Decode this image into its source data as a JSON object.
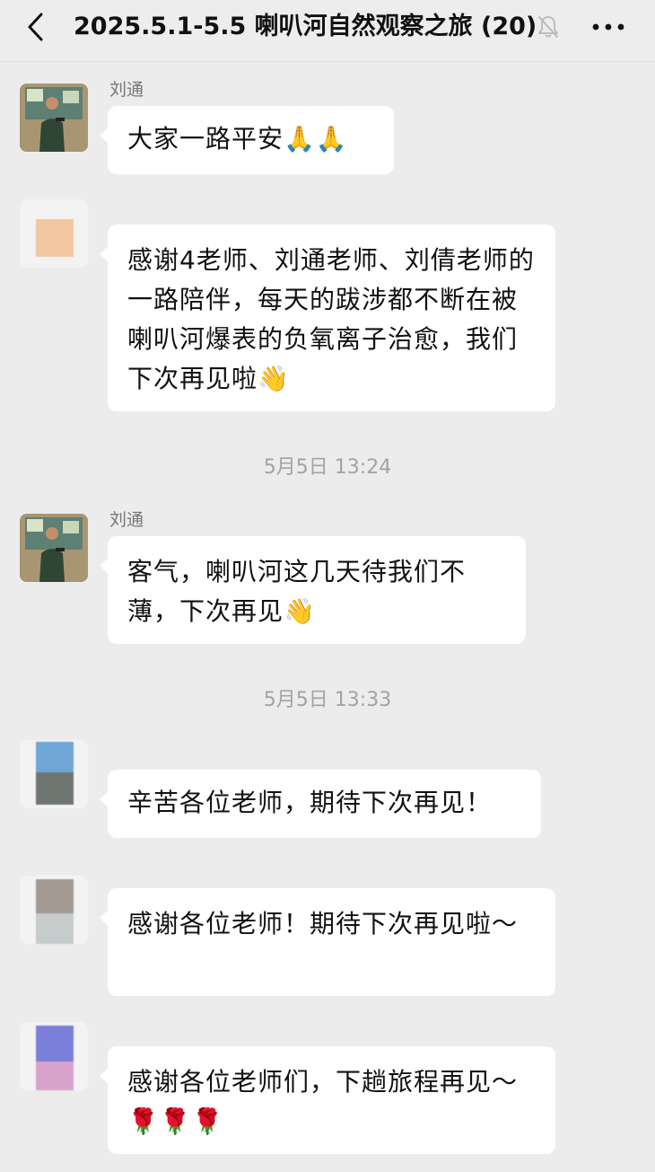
{
  "header": {
    "title": "2025.5.1-5.5 喇叭河自然观察之旅",
    "member_count": "(20)",
    "back_icon": "chevron-left-icon",
    "mute_icon": "bell-off-icon",
    "more_icon": "more-dots-icon"
  },
  "messages": [
    {
      "sender": "刘通",
      "text": "大家一路平安🙏🙏"
    },
    {
      "sender": "",
      "text": "感谢4老师、刘通老师、刘倩老师的一路陪伴，每天的跋涉都不断在被喇叭河爆表的负氧离子治愈，我们下次再见啦👋"
    },
    {
      "sender": "刘通",
      "text": "客气，喇叭河这几天待我们不薄，下次再见👋"
    },
    {
      "sender": "",
      "text": "辛苦各位老师，期待下次再见！"
    },
    {
      "sender": "",
      "text": "感谢各位老师！期待下次再见啦～"
    },
    {
      "sender": "",
      "text": "感谢各位老师们，下趟旅程再见～ 🌹🌹🌹"
    }
  ],
  "timestamps": [
    "5月5日 13:24",
    "5月5日 13:33"
  ],
  "colors": {
    "background": "#ececec",
    "bubble": "#ffffff",
    "timestamp": "#a3a3a3"
  }
}
